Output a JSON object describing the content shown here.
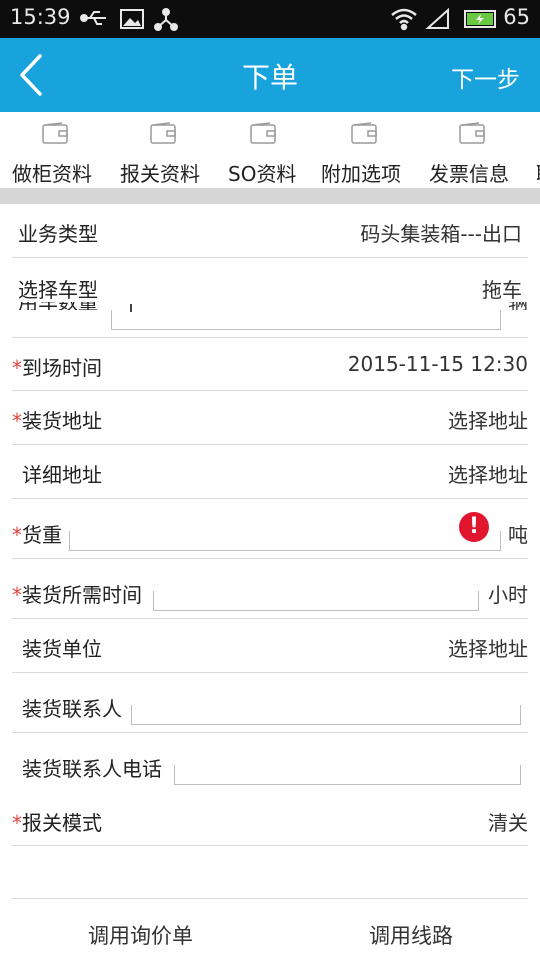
{
  "status_bar": {
    "time": "15:39",
    "battery": "65"
  },
  "nav": {
    "title": "下单",
    "next": "下一步"
  },
  "tabs": [
    "做柜资料",
    "报关资料",
    "SO资料",
    "附加选项",
    "发票信息",
    "联"
  ],
  "rows": {
    "business_type": {
      "label": "业务类型",
      "value": "码头集装箱---出口"
    },
    "vehicle_type": {
      "label": "选择车型",
      "value": "拖车"
    },
    "vehicle_count": {
      "label": "用车数量",
      "unit": "辆"
    },
    "arrival_time": {
      "required": "*",
      "label": "到场时间",
      "value": "2015-11-15 12:30"
    },
    "loading_address": {
      "required": "*",
      "label": "装货地址",
      "value": "选择地址"
    },
    "detail_address": {
      "label": "详细地址",
      "value": "选择地址"
    },
    "cargo_weight": {
      "required": "*",
      "label": "货重",
      "unit": "吨",
      "error_mark": "!"
    },
    "loading_duration": {
      "required": "*",
      "label": "装货所需时间",
      "unit": "小时"
    },
    "loading_unit": {
      "label": "装货单位",
      "value": "选择地址"
    },
    "loading_contact": {
      "label": "装货联系人"
    },
    "loading_contact_phone": {
      "label": "装货联系人电话"
    },
    "customs_mode": {
      "required": "*",
      "label": "报关模式",
      "value": "清关"
    }
  },
  "footer": {
    "left": "调用询价单",
    "right": "调用线路"
  },
  "colors": {
    "nav": "#18a3dc",
    "required": "#e0463b",
    "error": "#e2152f"
  }
}
